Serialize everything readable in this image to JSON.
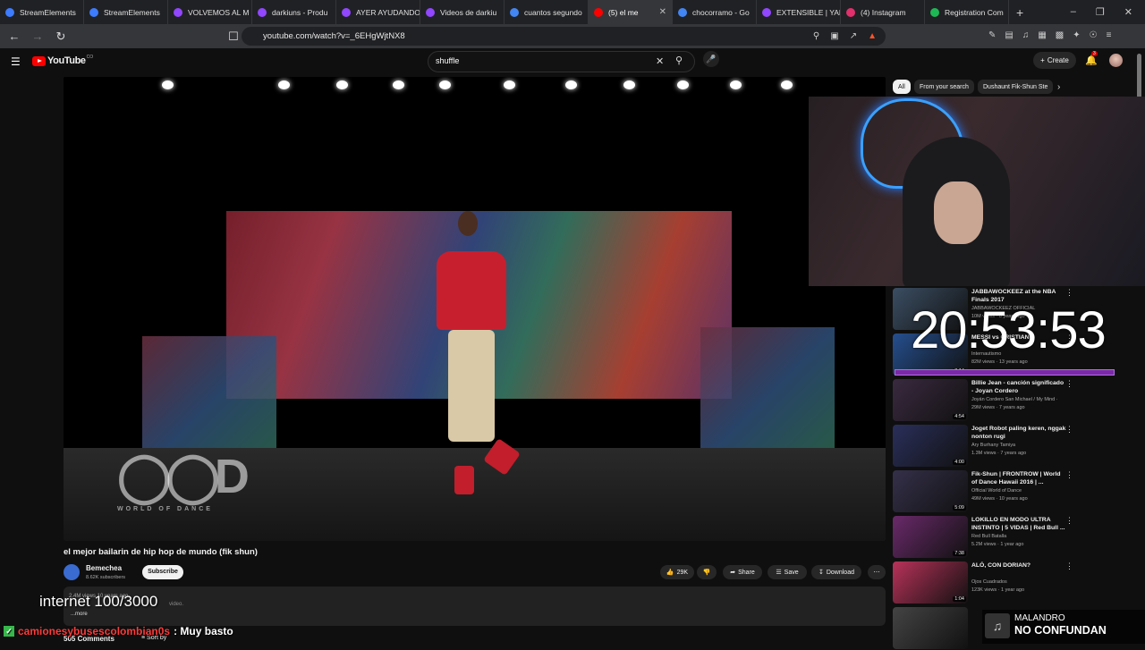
{
  "browser": {
    "tabs": [
      {
        "label": "StreamElements",
        "color": "#3d7bff"
      },
      {
        "label": "StreamElements",
        "color": "#3d7bff"
      },
      {
        "label": "VOLVEMOS AL M",
        "color": "#9146ff"
      },
      {
        "label": "darkiuns - Produ",
        "color": "#9146ff"
      },
      {
        "label": "AYER AYUDANDO",
        "color": "#9146ff"
      },
      {
        "label": "Videos de darkiu",
        "color": "#9146ff"
      },
      {
        "label": "cuantos segundo",
        "color": "#4285f4"
      },
      {
        "label": "(5) el me",
        "color": "#ff0000",
        "active": true
      },
      {
        "label": "chocorramo - Go",
        "color": "#4285f4"
      },
      {
        "label": "EXTENSIBLE | YAR",
        "color": "#9146ff"
      },
      {
        "label": "(4) Instagram",
        "color": "#e1306c"
      },
      {
        "label": "Registration Com",
        "color": "#1db954"
      }
    ],
    "url": "youtube.com/watch?v=_6EHgWjtNX8"
  },
  "youtube": {
    "logo": "YouTube",
    "logo_suffix": "CO",
    "search_value": "shuffle",
    "create_label": "Create",
    "notifications": "3"
  },
  "video": {
    "title": "el mejor bailarin de hip hop de mundo (fik shun)",
    "channel": "Bemechea",
    "subscribers": "8.62K subscribers",
    "subscribe_label": "Subscribe",
    "likes": "29K",
    "share_label": "Share",
    "save_label": "Save",
    "download_label": "Download",
    "desc_stats": "2.4M views  10 years ago",
    "desc_more": "...more",
    "desc_ghost": "video.",
    "comments": "505 Comments",
    "sort_label": "Sort by",
    "wod_text": "WORLD OF DANCE"
  },
  "chips": [
    {
      "label": "All",
      "active": true
    },
    {
      "label": "From your search"
    },
    {
      "label": "Dushaunt Fik-Shun Ste"
    }
  ],
  "recommendations": [
    {
      "title": "JABBAWOCKEEZ at the NBA Finals 2017",
      "channel": "JABBAWOCKEEZ OFFICIAL",
      "meta": "10M views · 8 years ago",
      "duration": "",
      "thumb": "#3b4e63"
    },
    {
      "title": "MESSI vs CRISTIANO",
      "channel": "Internautismo",
      "meta": "82M views · 13 years ago",
      "duration": "3:14",
      "thumb": "#254f8f"
    },
    {
      "title": "Billie Jean - canción significado - Joyan Cordero",
      "channel": "Joyán Cordero San Michael / My Mind ·",
      "meta": "29M views · 7 years ago",
      "duration": "4:54",
      "thumb": "#3a2a40"
    },
    {
      "title": "Joget Robot paling keren, nggak nonton rugi",
      "channel": "Ary Burhany Tamiya",
      "meta": "1.3M views · 7 years ago",
      "duration": "4:00",
      "thumb": "#2a2f5a"
    },
    {
      "title": "Fik-Shun | FRONTROW | World of Dance Hawaii 2016 | ...",
      "channel": "Official World of Dance",
      "meta": "49M views · 10 years ago",
      "duration": "5:09",
      "thumb": "#35304a"
    },
    {
      "title": "LOKILLO EN MODO ULTRA INSTINTO | 5 VIDAS | Red Bull ...",
      "channel": "Red Bull Batalla",
      "meta": "5.2M views · 1 year ago",
      "duration": "7:38",
      "thumb": "#6a2a6a"
    },
    {
      "title": "ALÓ, CON DORIAN?",
      "channel": "Ojos Cuadrados",
      "meta": "123K views · 1 year ago",
      "duration": "1:04",
      "thumb": "#b8325a"
    },
    {
      "title": "",
      "channel": "",
      "meta": "",
      "duration": "",
      "thumb": "#444444"
    }
  ],
  "overlay": {
    "clock": "20:53:53",
    "internet": "internet 100/3000",
    "chat_user": "camionesybusescolombian0s",
    "chat_msg": ": Muy basto",
    "music_artist": "MALANDRO",
    "music_song": "NO CONFUNDAN"
  },
  "icons": {
    "menu": "hamburger-icon",
    "search": "search-icon",
    "mic": "microphone-icon",
    "bell": "bell-icon",
    "like": "thumbs-up-icon",
    "dislike": "thumbs-down-icon"
  }
}
